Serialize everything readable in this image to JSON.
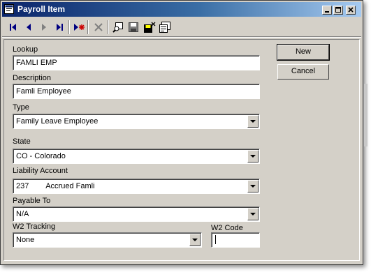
{
  "window": {
    "title": "Payroll Item"
  },
  "title_buttons": [
    "minimize",
    "maximize",
    "close"
  ],
  "toolbar": {
    "buttons": [
      "first-record",
      "previous-record",
      "next-record",
      "last-record",
      "new-record",
      "delete-record",
      "find",
      "save",
      "save-and-close",
      "properties"
    ]
  },
  "form": {
    "lookup": {
      "label": "Lookup",
      "value": "FAMLI EMP"
    },
    "description": {
      "label": "Description",
      "value": "Famli Employee"
    },
    "type": {
      "label": "Type",
      "value": "Family Leave Employee"
    },
    "state": {
      "label": "State",
      "value": "CO - Colorado"
    },
    "liability_account": {
      "label": "Liability Account",
      "value": "237        Accrued Famli"
    },
    "payable_to": {
      "label": "Payable To",
      "value": "N/A"
    },
    "w2_tracking": {
      "label": "W2 Tracking",
      "value": "None"
    },
    "w2_code": {
      "label": "W2 Code",
      "value": ""
    }
  },
  "actions": {
    "new_label": "New",
    "cancel_label": "Cancel"
  },
  "colors": {
    "title_start": "#0a246a",
    "title_end": "#a6caf0",
    "face": "#d4d0c8",
    "new_marker": "#cc0000",
    "nav": "#000080"
  }
}
